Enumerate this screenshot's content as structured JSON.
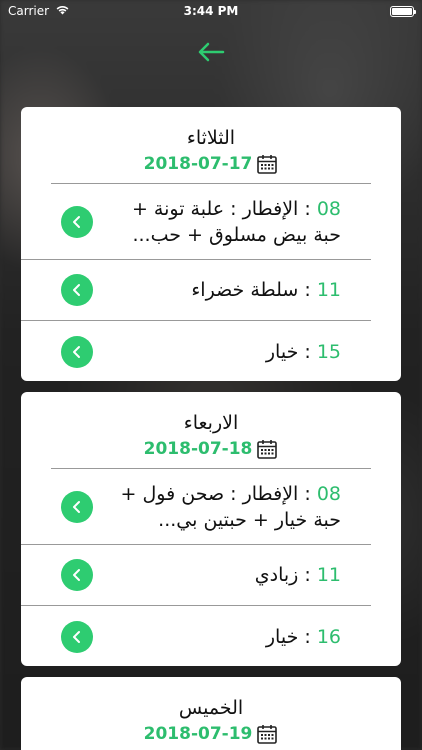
{
  "status": {
    "carrier": "Carrier",
    "time": "3:44 PM"
  },
  "accent_color": "#2ecc71",
  "days": [
    {
      "day": "الثلاثاء",
      "date": "2018-07-17",
      "meals": [
        {
          "time": "08",
          "text": "الإفطار : علبة تونة + حبة بيض مسلوق + حب..."
        },
        {
          "time": "11",
          "text": "سلطة خضراء"
        },
        {
          "time": "15",
          "text": "خيار"
        }
      ]
    },
    {
      "day": "الاربعاء",
      "date": "2018-07-18",
      "meals": [
        {
          "time": "08",
          "text": "الإفطار : صحن فول + حبة خيار + حبتين بي..."
        },
        {
          "time": "11",
          "text": "زبادي"
        },
        {
          "time": "16",
          "text": "خيار"
        }
      ]
    },
    {
      "day": "الخميس",
      "date": "2018-07-19",
      "meals": []
    }
  ]
}
